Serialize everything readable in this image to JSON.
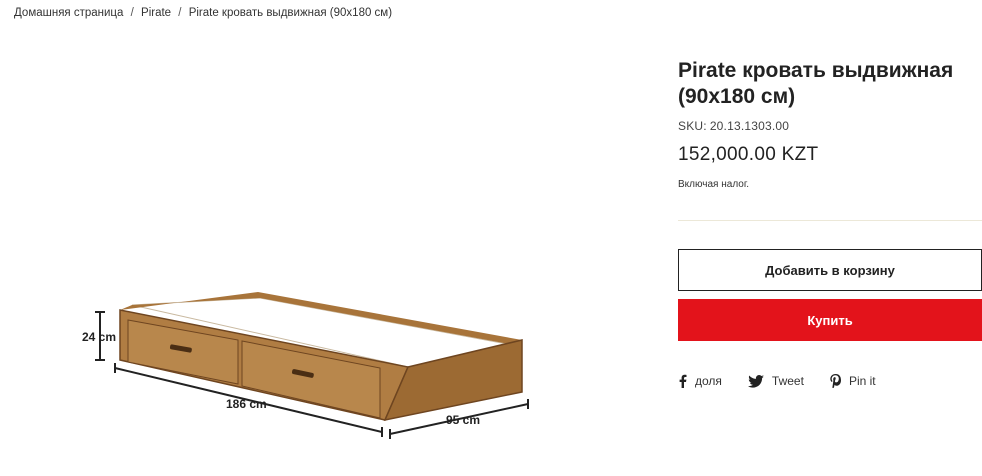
{
  "breadcrumb": {
    "home": "Домашняя страница",
    "separator": "/",
    "category": "Pirate",
    "current": "Pirate кровать выдвижная (90x180 см)"
  },
  "product_image": {
    "dim_height": "24 cm",
    "dim_length": "186 cm",
    "dim_width": "95 cm",
    "colors": {
      "wood": "#a8743a",
      "wood_dark": "#7a4e23",
      "mattress": "#ffffff"
    }
  },
  "product": {
    "title": "Pirate кровать выдвижная (90x180 см)",
    "sku_label": "SKU:",
    "sku_value": "20.13.1303.00",
    "price": "152,000.00 KZT",
    "tax_note": "Включая налог."
  },
  "actions": {
    "add_to_cart": "Добавить в корзину",
    "buy": "Купить",
    "buy_color": "#e3131b"
  },
  "share": {
    "facebook": {
      "label": "доля",
      "icon": "facebook-icon"
    },
    "twitter": {
      "label": "Tweet",
      "icon": "twitter-icon"
    },
    "pinterest": {
      "label": "Pin it",
      "icon": "pinterest-icon"
    }
  }
}
